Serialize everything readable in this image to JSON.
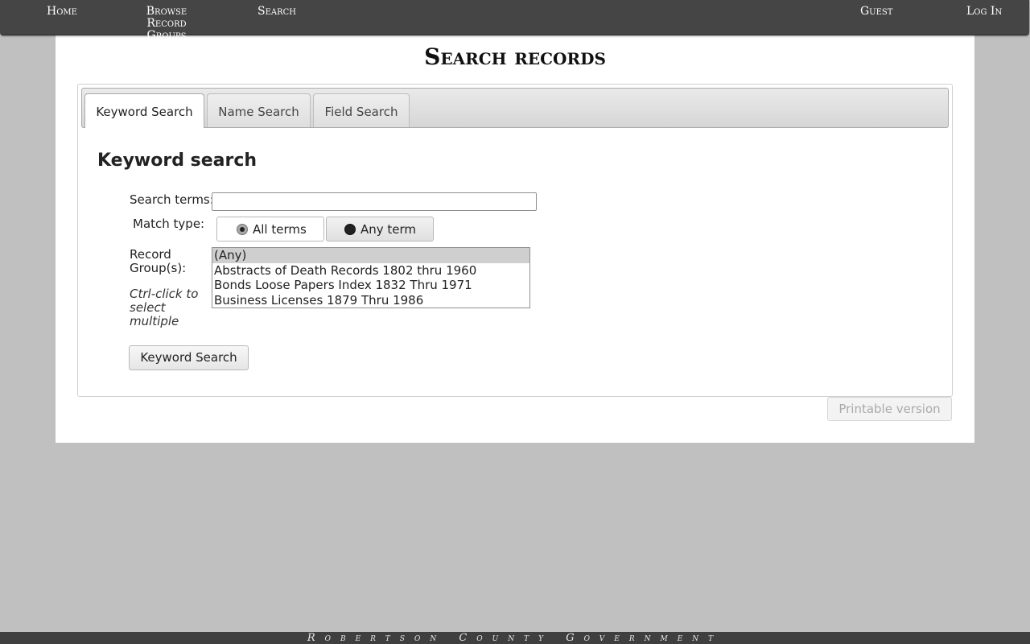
{
  "nav": {
    "home": "Home",
    "browse": "Browse Record Groups",
    "search": "Search",
    "guest": "Guest",
    "login": "Log In"
  },
  "page": {
    "title": "Search records",
    "tabs": [
      "Keyword Search",
      "Name Search",
      "Field Search"
    ],
    "active_tab": "Keyword Search",
    "section_title": "Keyword search",
    "form": {
      "search_terms_label": "Search terms:",
      "search_terms_value": "",
      "match_type_label": "Match type:",
      "match_options": [
        "All terms",
        "Any term"
      ],
      "match_selected": "All terms",
      "record_groups_label": "Record Group(s):",
      "record_groups_hint": "Ctrl-click to select multiple",
      "record_groups_options": [
        "(Any)",
        "Abstracts of Death Records 1802 thru 1960",
        "Bonds Loose Papers Index 1832 Thru 1971",
        "Business Licenses 1879 Thru 1986"
      ],
      "record_groups_selected": "(Any)",
      "submit_label": "Keyword Search"
    },
    "printable_label": "Printable version"
  },
  "footer": {
    "text": "Robertson County Government"
  },
  "colors": {
    "nav_bg": "#454545",
    "page_bg": "#c0c0c0",
    "content_bg": "#ffffff"
  }
}
